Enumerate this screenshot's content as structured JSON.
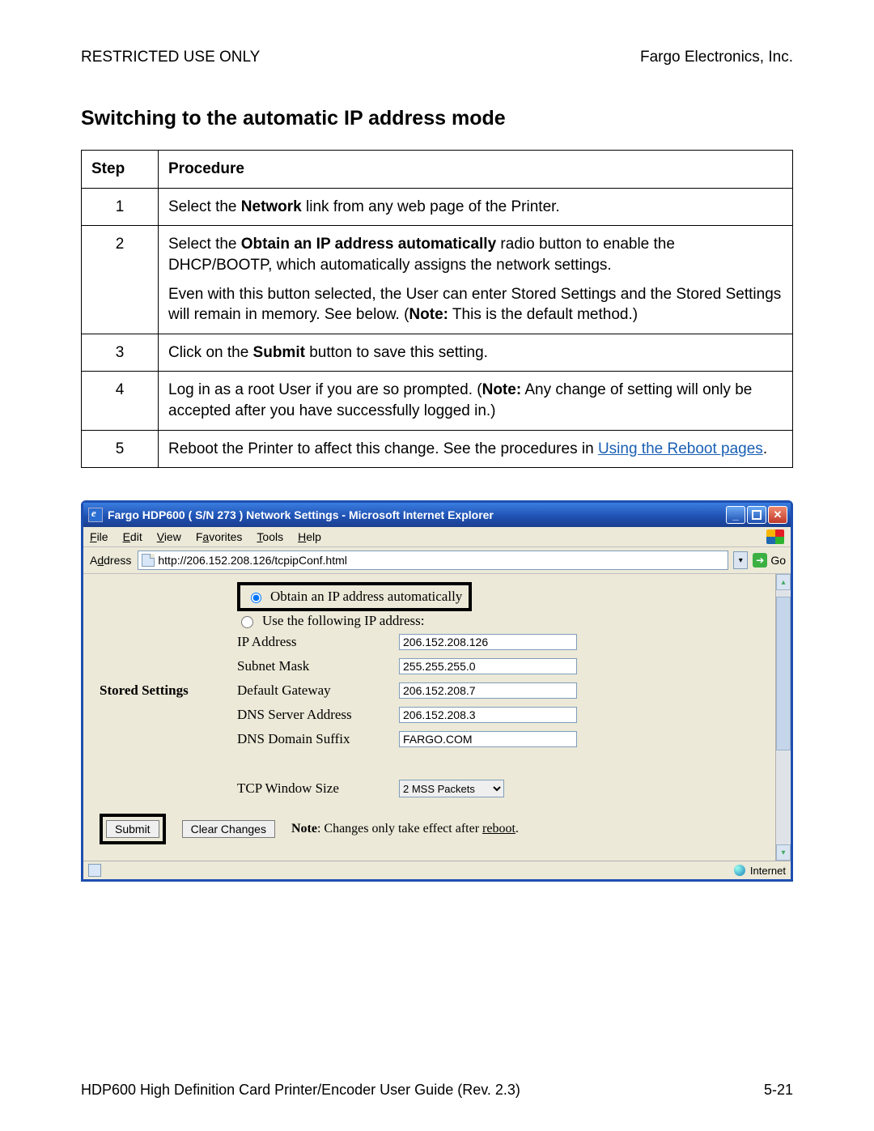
{
  "header": {
    "left": "RESTRICTED USE ONLY",
    "right": "Fargo Electronics, Inc."
  },
  "title": "Switching to the automatic IP address mode",
  "table": {
    "col_step": "Step",
    "col_proc": "Procedure",
    "rows": {
      "r1": {
        "n": "1",
        "t1": "Select the ",
        "b1": "Network",
        "t2": " link from any web page of the Printer."
      },
      "r2": {
        "n": "2",
        "p1a": "Select the ",
        "p1b": "Obtain an IP address automatically",
        "p1c": " radio button to enable the DHCP/BOOTP, which automatically assigns the network settings.",
        "p2a": "Even with this button selected, the User can enter Stored Settings and the Stored Settings will remain in memory. See below. (",
        "p2b": "Note:",
        "p2c": "  This is the default method.)"
      },
      "r3": {
        "n": "3",
        "t1": "Click on the ",
        "b1": "Submit",
        "t2": " button to save this setting."
      },
      "r4": {
        "n": "4",
        "t1": "Log in as a root User if you are so prompted. (",
        "b1": "Note:",
        "t2": "  Any change of setting will only be accepted after you have successfully logged in.)"
      },
      "r5": {
        "n": "5",
        "t1": "Reboot the Printer to affect this change. See the procedures in ",
        "link": "Using the Reboot pages",
        "t2": "."
      }
    }
  },
  "ie": {
    "title": "Fargo HDP600 ( S/N 273 ) Network Settings - Microsoft Internet Explorer",
    "menus": {
      "file": "File",
      "edit": "Edit",
      "view": "View",
      "fav": "Favorites",
      "tools": "Tools",
      "help": "Help"
    },
    "address_label": "Address",
    "url": "http://206.152.208.126/tcpipConf.html",
    "go": "Go",
    "radio_auto": "Obtain an IP address automatically",
    "radio_manual": "Use the following IP address:",
    "stored_label": "Stored Settings",
    "fields": {
      "ip_label": "IP Address",
      "ip_val": "206.152.208.126",
      "mask_label": "Subnet Mask",
      "mask_val": "255.255.255.0",
      "gw_label": "Default Gateway",
      "gw_val": "206.152.208.7",
      "dns_label": "DNS Server Address",
      "dns_val": "206.152.208.3",
      "suffix_label": "DNS Domain Suffix",
      "suffix_val": "FARGO.COM",
      "tcp_label": "TCP Window Size",
      "tcp_val": "2 MSS Packets"
    },
    "submit": "Submit",
    "clear": "Clear Changes",
    "note_b": "Note",
    "note_t": ": Changes only take effect after ",
    "note_link": "reboot",
    "note_end": ".",
    "status_zone": "Internet"
  },
  "footer": {
    "left": "HDP600 High Definition Card Printer/Encoder User Guide (Rev. 2.3)",
    "right": "5-21"
  }
}
